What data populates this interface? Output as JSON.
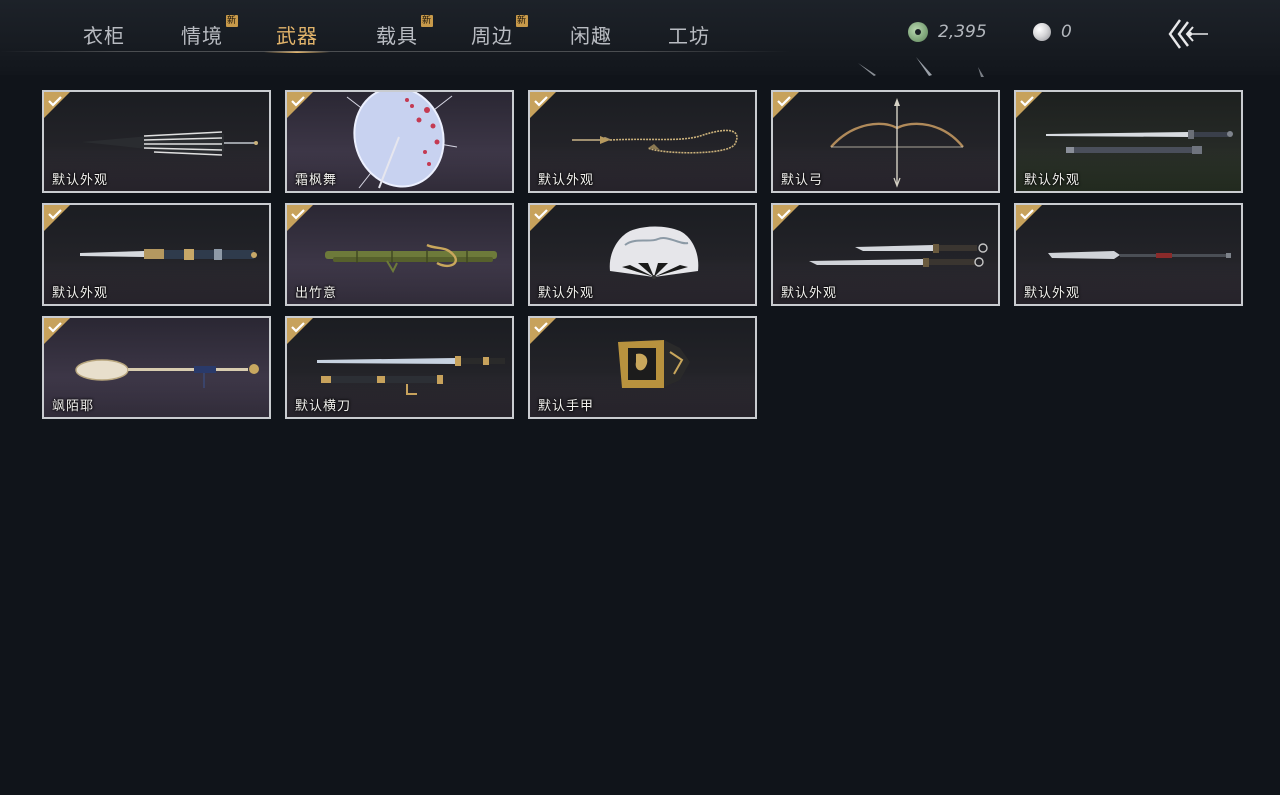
{
  "tabs": [
    {
      "label": "衣柜",
      "new": false,
      "active": false
    },
    {
      "label": "情境",
      "new": true,
      "active": false
    },
    {
      "label": "武器",
      "new": false,
      "active": true
    },
    {
      "label": "载具",
      "new": true,
      "active": false
    },
    {
      "label": "周边",
      "new": true,
      "active": false
    },
    {
      "label": "闲趣",
      "new": false,
      "active": false
    },
    {
      "label": "工坊",
      "new": false,
      "active": false
    }
  ],
  "new_badge": "新",
  "currency": {
    "jade": {
      "icon": "jade-coin-icon",
      "value": "2,395"
    },
    "pearl": {
      "icon": "pearl-icon",
      "value": "0"
    }
  },
  "back_button": {
    "icon": "back-arrow-icon"
  },
  "weapons": [
    {
      "name": "默认外观",
      "icon": "umbrella-closed-icon",
      "equipped": true
    },
    {
      "name": "霜枫舞",
      "icon": "umbrella-open-icon",
      "equipped": true
    },
    {
      "name": "默认外观",
      "icon": "rope-dart-icon",
      "equipped": true
    },
    {
      "name": "默认弓",
      "icon": "bow-icon",
      "equipped": true
    },
    {
      "name": "默认外观",
      "icon": "long-sword-icon",
      "equipped": true
    },
    {
      "name": "默认外观",
      "icon": "blade-icon",
      "equipped": true
    },
    {
      "name": "出竹意",
      "icon": "bamboo-staff-icon",
      "equipped": true
    },
    {
      "name": "默认外观",
      "icon": "fan-icon",
      "equipped": true
    },
    {
      "name": "默认外观",
      "icon": "dual-blades-icon",
      "equipped": true
    },
    {
      "name": "默认外观",
      "icon": "spear-icon",
      "equipped": true
    },
    {
      "name": "飒陌耶",
      "icon": "staff-icon",
      "equipped": true
    },
    {
      "name": "默认横刀",
      "icon": "hengdao-icon",
      "equipped": true
    },
    {
      "name": "默认手甲",
      "icon": "gauntlet-icon",
      "equipped": true
    }
  ],
  "colors": {
    "accent": "#e2b46b",
    "badge": "#c89a4a",
    "background": "#10141a"
  }
}
